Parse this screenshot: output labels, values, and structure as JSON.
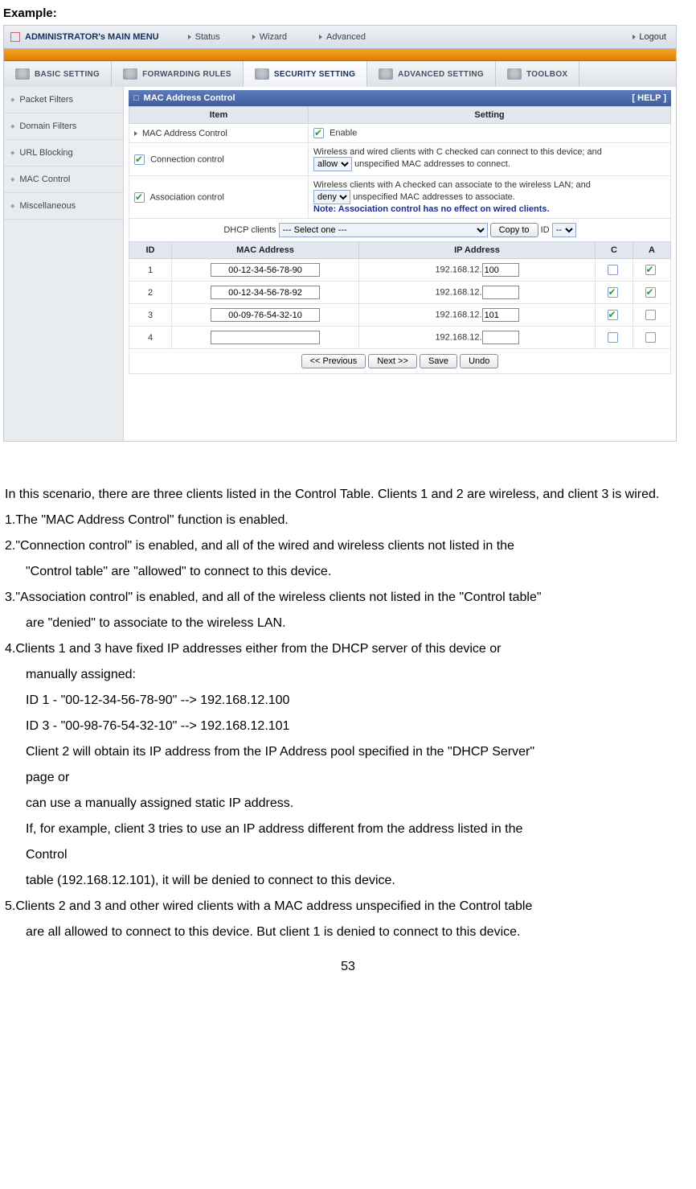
{
  "doc": {
    "example_label": "Example:",
    "intro": "In this scenario, there are three clients listed in the Control Table. Clients 1 and 2 are wireless, and client 3 is wired.",
    "p1": "1.The \"MAC Address Control\" function is enabled.",
    "p2a": "2.\"Connection control\" is enabled, and all of the wired and wireless clients not listed in the",
    "p2b": "\"Control table\" are \"allowed\" to connect to this device.",
    "p3a": "3.\"Association control\" is enabled, and all of the wireless clients not listed in the \"Control table\"",
    "p3b": "are \"denied\" to associate to the wireless LAN.",
    "p4a": "4.Clients 1 and 3 have fixed IP addresses either from the DHCP server of this device or",
    "p4b": "manually assigned:",
    "p4_id1": "ID 1 - \"00-12-34-56-78-90\" --> 192.168.12.100",
    "p4_id3": "ID 3 - \"00-98-76-54-32-10\" --> 192.168.12.101",
    "p4c": "Client 2 will obtain its IP address from the IP Address pool specified in the \"DHCP Server\"",
    "p4d": "page or",
    "p4e": "can use a manually assigned static IP address.",
    "p4f": "If, for example, client 3 tries to use an IP address different from the address listed in the",
    "p4g": "Control",
    "p4h": "table (192.168.12.101), it will be denied to connect to this device.",
    "p5a": "5.Clients 2 and 3 and other wired clients with a MAC address unspecified in the Control table",
    "p5b": "are all allowed to connect to this device. But client 1 is denied to connect to this device.",
    "page_number": "53"
  },
  "ui": {
    "top": {
      "title": "ADMINISTRATOR's MAIN MENU",
      "nav": [
        "Status",
        "Wizard",
        "Advanced"
      ],
      "logout": "Logout"
    },
    "tabs": [
      "BASIC SETTING",
      "FORWARDING RULES",
      "SECURITY SETTING",
      "ADVANCED SETTING",
      "TOOLBOX"
    ],
    "sidebar": [
      "Packet Filters",
      "Domain Filters",
      "URL Blocking",
      "MAC Control",
      "Miscellaneous"
    ],
    "panel": {
      "title": "MAC Address Control",
      "help": "[ HELP ]",
      "th_item": "Item",
      "th_setting": "Setting",
      "rows": [
        {
          "label": "MAC Address Control",
          "setting": "Enable"
        },
        {
          "label": "Connection control",
          "line1": "Wireless and wired clients with C checked can connect to this device; and",
          "select": "allow",
          "line2": " unspecified MAC addresses to connect."
        },
        {
          "label": "Association control",
          "line1": "Wireless clients with A checked can associate to the wireless LAN; and",
          "select": "deny",
          "line2": " unspecified MAC addresses to associate.",
          "note": "Note: Association control has no effect on wired clients."
        }
      ],
      "dhcp": {
        "label": "DHCP clients ",
        "select": "--- Select one ---",
        "copy": "Copy to",
        "id_label": " ID ",
        "id_val": "--"
      }
    },
    "ct": {
      "headers": [
        "ID",
        "MAC Address",
        "IP Address",
        "C",
        "A"
      ],
      "ip_prefix": "192.168.12.",
      "rows": [
        {
          "id": "1",
          "mac": "00-12-34-56-78-90",
          "ip": "100",
          "c": false,
          "a": true
        },
        {
          "id": "2",
          "mac": "00-12-34-56-78-92",
          "ip": "",
          "c": true,
          "a": true
        },
        {
          "id": "3",
          "mac": "00-09-76-54-32-10",
          "ip": "101",
          "c": true,
          "a": false
        },
        {
          "id": "4",
          "mac": "",
          "ip": "",
          "c": false,
          "a": false
        }
      ]
    },
    "buttons": [
      "<< Previous",
      "Next >>",
      "Save",
      "Undo"
    ]
  }
}
